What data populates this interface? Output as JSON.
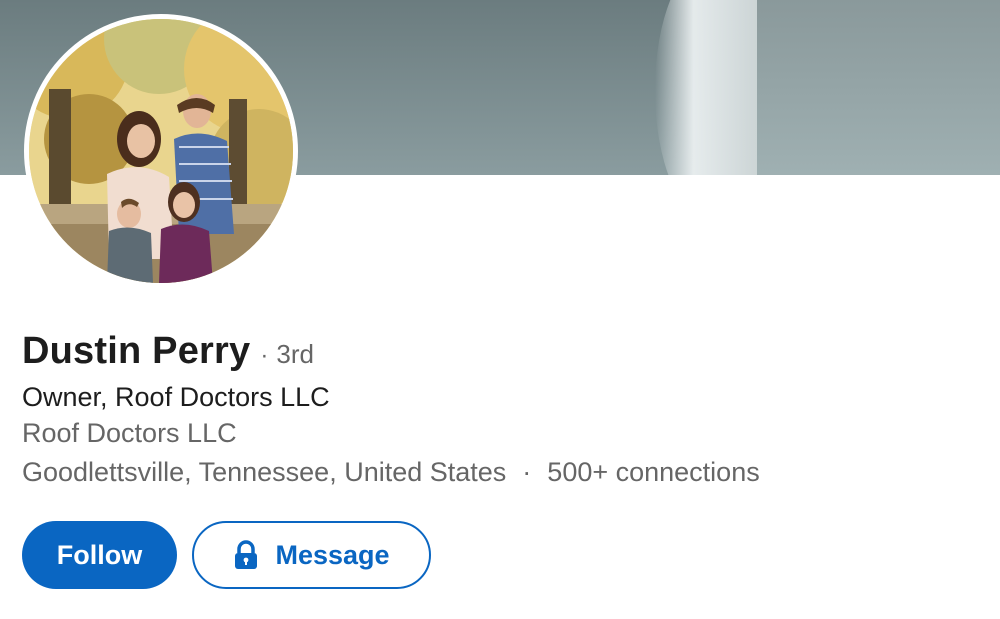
{
  "profile": {
    "name": "Dustin Perry",
    "degree_separator": "·",
    "degree": "3rd",
    "headline": "Owner, Roof Doctors LLC",
    "company": "Roof Doctors LLC",
    "location": "Goodlettsville, Tennessee, United States",
    "meta_separator": "·",
    "connections": "500+ connections"
  },
  "actions": {
    "follow_label": "Follow",
    "message_label": "Message",
    "message_icon": "lock-icon"
  },
  "colors": {
    "primary": "#0a66c2",
    "text_primary": "#1d1d1d",
    "text_secondary": "#666666"
  }
}
